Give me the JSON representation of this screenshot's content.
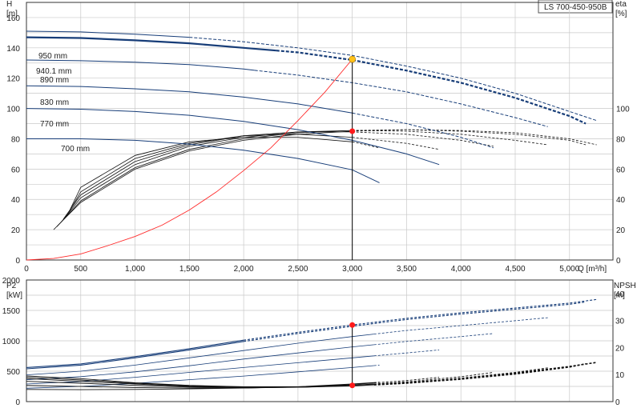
{
  "chart_data": [
    {
      "type": "line",
      "id": "head",
      "title_box": "LS 700-450-950B",
      "ylabel": "H",
      "yunit": "[m]",
      "y2label": "eta",
      "y2unit": "[%]",
      "xlabel": "Q [m³/h]",
      "xlim": [
        0,
        5400
      ],
      "ylim": [
        0,
        170
      ],
      "xticks": [
        0,
        500,
        1000,
        1500,
        2000,
        2500,
        3000,
        3500,
        4000,
        4500,
        5000
      ],
      "xtick_labels": [
        "0",
        "500",
        "1,000",
        "1,500",
        "2,000",
        "2,500",
        "3,000",
        "3,500",
        "4,000",
        "4,500",
        "5,000"
      ],
      "yticks": [
        0,
        20,
        40,
        60,
        80,
        100,
        120,
        140,
        160
      ],
      "y2ticks": [
        0,
        20,
        40,
        60,
        80,
        100
      ],
      "grid": true,
      "head_curves": [
        {
          "name": "950 mm",
          "solid_end": 1500,
          "x": [
            0,
            500,
            1000,
            1500,
            2000,
            2500,
            3000,
            3500,
            4000,
            4500,
            5000,
            5250
          ],
          "y": [
            151,
            150.5,
            149,
            147,
            144,
            140,
            135,
            128,
            120,
            110,
            98,
            92
          ]
        },
        {
          "name": "940.1 mm",
          "solid_end": 2300,
          "highlight": true,
          "x": [
            0,
            500,
            1000,
            1500,
            2000,
            2500,
            3000,
            3500,
            4000,
            4500,
            5000,
            5150
          ],
          "y": [
            147,
            146.5,
            145,
            143,
            140,
            137,
            132,
            125,
            117,
            107,
            95,
            90
          ]
        },
        {
          "name": "890 mm",
          "solid_end": 2100,
          "x": [
            0,
            500,
            1000,
            1500,
            2000,
            2500,
            3000,
            3500,
            4000,
            4500,
            4800
          ],
          "y": [
            132,
            131.5,
            130.5,
            129,
            126,
            122,
            117,
            111,
            103,
            94,
            88
          ]
        },
        {
          "name": "830 mm",
          "solid_end": 3000,
          "x": [
            0,
            500,
            1000,
            1500,
            2000,
            2500,
            3000,
            3500,
            4000,
            4300
          ],
          "y": [
            115,
            114.5,
            113,
            111,
            107.5,
            103,
            97,
            90,
            81,
            74
          ]
        },
        {
          "name": "770 mm",
          "solid_end": 3800,
          "x": [
            0,
            500,
            1000,
            1500,
            2000,
            2500,
            3000,
            3500,
            3800
          ],
          "y": [
            100,
            99.5,
            98,
            95.5,
            91.5,
            86,
            79,
            70,
            63
          ]
        },
        {
          "name": "700 mm",
          "solid_end": 3250,
          "x": [
            0,
            500,
            1000,
            1500,
            2000,
            2500,
            3000,
            3250
          ],
          "y": [
            80,
            80,
            79,
            76.5,
            72.5,
            67,
            59.5,
            51
          ]
        }
      ],
      "efficiency_curves": [
        {
          "x": [
            250,
            500,
            1000,
            1500,
            2000,
            2500,
            3000,
            3500,
            4000,
            4500,
            5000,
            5250
          ],
          "y": [
            20,
            38,
            60,
            72,
            79,
            83,
            85,
            86,
            85.5,
            84,
            80,
            76
          ]
        },
        {
          "x": [
            280,
            500,
            1000,
            1500,
            2000,
            2500,
            3000,
            3500,
            4000,
            4500,
            5000,
            5150
          ],
          "y": [
            22,
            39,
            61,
            73,
            80,
            84,
            85.5,
            86,
            85,
            83,
            79,
            76
          ]
        },
        {
          "x": [
            320,
            500,
            1000,
            1500,
            2000,
            2500,
            3000,
            3500,
            4000,
            4500,
            4800
          ],
          "y": [
            25,
            41,
            63,
            75,
            81,
            84.5,
            85.5,
            85,
            83,
            79,
            76
          ]
        },
        {
          "x": [
            340,
            500,
            1000,
            1500,
            2000,
            2500,
            3000,
            3500,
            4000,
            4300
          ],
          "y": [
            27,
            43,
            65,
            76,
            82,
            84.5,
            84.5,
            83,
            79,
            75
          ]
        },
        {
          "x": [
            370,
            500,
            1000,
            1500,
            2000,
            2500,
            3000,
            3500,
            3800
          ],
          "y": [
            29,
            45,
            67,
            77,
            82,
            83,
            81,
            77,
            73
          ]
        },
        {
          "x": [
            400,
            500,
            1000,
            1500,
            2000,
            2500,
            3000,
            3250
          ],
          "y": [
            33,
            48,
            69,
            78,
            81,
            81,
            78,
            74
          ]
        }
      ],
      "system_curve": {
        "color": "#ff2a2a",
        "x": [
          0,
          250,
          500,
          750,
          1000,
          1250,
          1500,
          1750,
          2000,
          2250,
          2500,
          2750,
          3000
        ],
        "y": [
          0,
          1,
          4,
          9.5,
          15.5,
          23,
          33,
          45,
          59,
          74,
          92,
          111,
          132.5
        ]
      },
      "operating_point": {
        "x": 3000,
        "head": 132.5,
        "eta": 85
      },
      "colors": {
        "head": "#173d78",
        "efficiency": "#111111",
        "system": "#ff2a2a",
        "point_red": "#ff1a1a",
        "point_yellow": "#ffc21a",
        "grid": "#c9c9c9"
      }
    },
    {
      "type": "line",
      "id": "power",
      "ylabel": "P2",
      "yunit": "[kW]",
      "y2label": "NPSH",
      "y2unit": "[m]",
      "xlim": [
        0,
        5400
      ],
      "ylim": [
        0,
        2000
      ],
      "yticks": [
        0,
        500,
        1000,
        1500,
        2000
      ],
      "y2lim": [
        0,
        45
      ],
      "y2ticks": [
        0,
        10,
        20,
        30,
        40
      ],
      "grid": true,
      "power_curves": [
        {
          "x": [
            0,
            500,
            1000,
            1500,
            2000,
            2500,
            3000,
            3500,
            4000,
            4500,
            5000,
            5250
          ],
          "y": [
            560,
            620,
            740,
            870,
            1010,
            1140,
            1260,
            1370,
            1460,
            1540,
            1620,
            1680
          ]
        },
        {
          "x": [
            0,
            500,
            1000,
            1500,
            2000,
            2500,
            3000,
            3500,
            4000,
            4500,
            5000,
            5150
          ],
          "y": [
            540,
            600,
            720,
            850,
            990,
            1120,
            1240,
            1350,
            1440,
            1520,
            1600,
            1640
          ]
        },
        {
          "x": [
            0,
            500,
            1000,
            1500,
            2000,
            2500,
            3000,
            3500,
            4000,
            4500,
            4800
          ],
          "y": [
            440,
            500,
            600,
            720,
            840,
            960,
            1070,
            1170,
            1250,
            1330,
            1380
          ]
        },
        {
          "x": [
            0,
            500,
            1000,
            1500,
            2000,
            2500,
            3000,
            3500,
            4000,
            4300
          ],
          "y": [
            360,
            410,
            490,
            590,
            700,
            800,
            900,
            990,
            1070,
            1120
          ]
        },
        {
          "x": [
            0,
            500,
            1000,
            1500,
            2000,
            2500,
            3000,
            3500,
            3800
          ],
          "y": [
            290,
            330,
            400,
            480,
            560,
            640,
            720,
            800,
            850
          ]
        },
        {
          "x": [
            0,
            500,
            1000,
            1500,
            2000,
            2500,
            3000,
            3250
          ],
          "y": [
            220,
            250,
            300,
            360,
            420,
            490,
            560,
            600
          ]
        }
      ],
      "npsh_curves": [
        {
          "x": [
            0,
            500,
            1000,
            1500,
            2000,
            2500,
            3000,
            3500,
            4000,
            4500,
            5000,
            5250
          ],
          "y": [
            9.5,
            8.5,
            7,
            6,
            5.5,
            5.5,
            6,
            7,
            8.5,
            10.5,
            13,
            14.5
          ]
        },
        {
          "x": [
            0,
            500,
            1000,
            1500,
            2000,
            2500,
            3000,
            3500,
            4000,
            4500,
            5000,
            5150
          ],
          "y": [
            9,
            8,
            6.8,
            5.8,
            5.3,
            5.3,
            5.8,
            6.8,
            8.3,
            10.2,
            12.8,
            14
          ]
        },
        {
          "x": [
            0,
            500,
            1000,
            1500,
            2000,
            2500,
            3000,
            3500,
            4000,
            4500,
            4800
          ],
          "y": [
            8.5,
            7.5,
            6.5,
            5.6,
            5.2,
            5.3,
            5.9,
            7,
            8.7,
            10.8,
            12.5
          ]
        },
        {
          "x": [
            0,
            500,
            1000,
            1500,
            2000,
            2500,
            3000,
            3500,
            4000,
            4300
          ],
          "y": [
            7.5,
            6.8,
            6,
            5.4,
            5.1,
            5.3,
            6,
            7.3,
            9.2,
            10.8
          ]
        },
        {
          "x": [
            0,
            500,
            1000,
            1500,
            2000,
            2500,
            3000,
            3500,
            3800
          ],
          "y": [
            6,
            5.6,
            5.2,
            5,
            5,
            5.4,
            6.3,
            7.8,
            9
          ]
        },
        {
          "x": [
            0,
            500,
            1000,
            1500,
            2000,
            2500,
            3000,
            3250
          ],
          "y": [
            4.5,
            4.4,
            4.5,
            4.7,
            5,
            5.5,
            6.5,
            7.2
          ]
        }
      ],
      "operating_point": {
        "x": 3000,
        "power": 1260,
        "npsh": 6
      },
      "colors": {
        "power": "#173d78",
        "npsh": "#111111",
        "point_red": "#ff1a1a",
        "grid": "#c9c9c9"
      }
    }
  ]
}
